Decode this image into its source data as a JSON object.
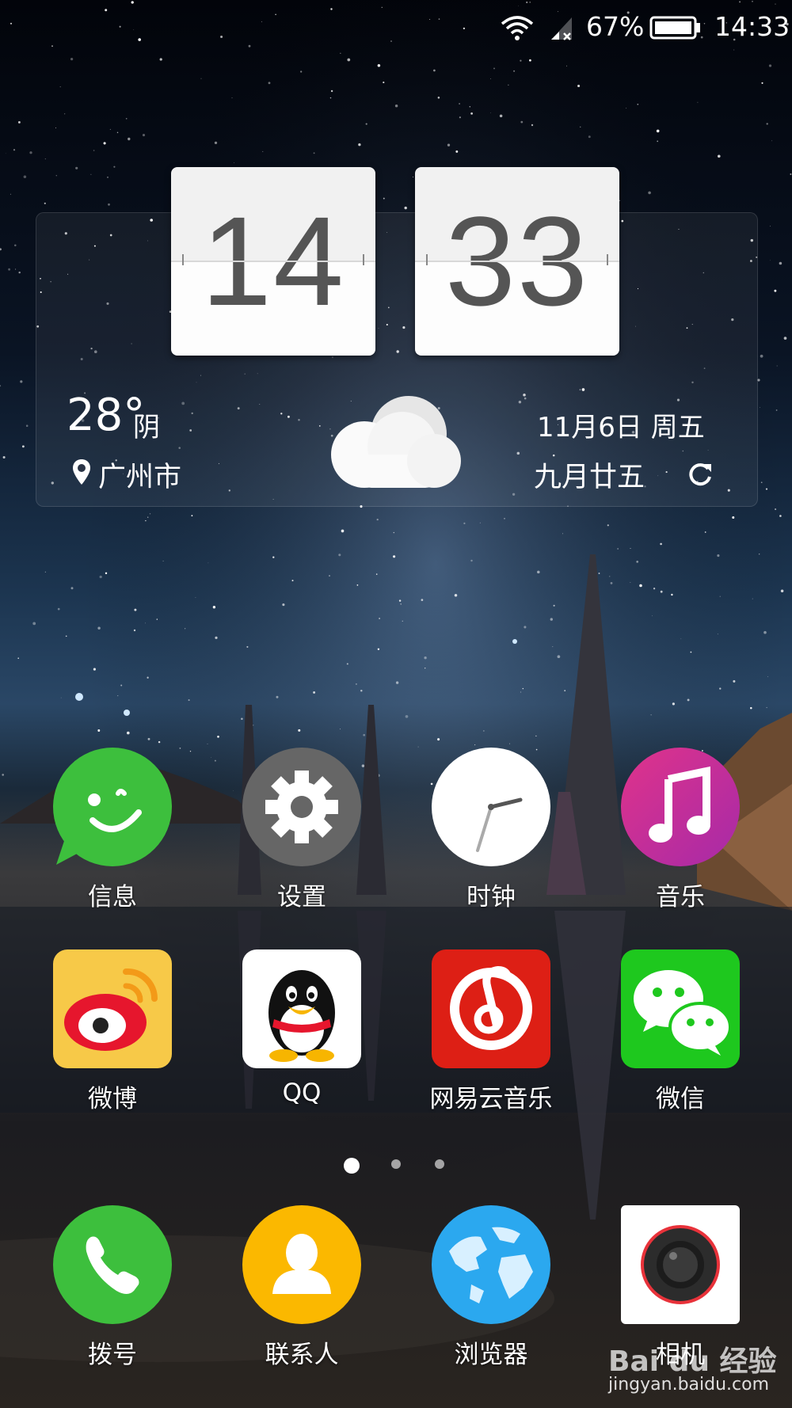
{
  "status_bar": {
    "battery_percent": "67%",
    "time": "14:33"
  },
  "clock_widget": {
    "hour": "14",
    "minute": "33",
    "temperature": "28°",
    "condition": "阴",
    "city": "广州市",
    "date": "11月6日 周五",
    "lunar_date": "九月廿五",
    "weather_icon": "cloud-icon",
    "location_icon": "location-pin-icon",
    "refresh_icon": "refresh-icon"
  },
  "apps": [
    {
      "label": "信息",
      "icon": "message-icon",
      "color": "#3dbf3d"
    },
    {
      "label": "设置",
      "icon": "gear-icon",
      "color": "#666666"
    },
    {
      "label": "时钟",
      "icon": "clock-icon",
      "color": "#ffffff"
    },
    {
      "label": "音乐",
      "icon": "music-note-icon",
      "color": "#c72a9a"
    },
    {
      "label": "微博",
      "icon": "weibo-icon",
      "color": "#f7c948"
    },
    {
      "label": "QQ",
      "icon": "qq-penguin-icon",
      "color": "#ffffff"
    },
    {
      "label": "网易云音乐",
      "icon": "netease-music-icon",
      "color": "#dd1f15"
    },
    {
      "label": "微信",
      "icon": "wechat-icon",
      "color": "#1ec81e"
    }
  ],
  "page_indicator": {
    "pages": 3,
    "current": 1
  },
  "dock": [
    {
      "label": "拨号",
      "icon": "phone-icon",
      "color": "#3dbf3d"
    },
    {
      "label": "联系人",
      "icon": "contact-icon",
      "color": "#fbb800"
    },
    {
      "label": "浏览器",
      "icon": "globe-icon",
      "color": "#2ba8ef"
    },
    {
      "label": "相机",
      "icon": "camera-icon",
      "color": "#ffffff"
    }
  ],
  "watermark": {
    "line1": "Bai du 经验",
    "line2": "jingyan.baidu.com"
  }
}
